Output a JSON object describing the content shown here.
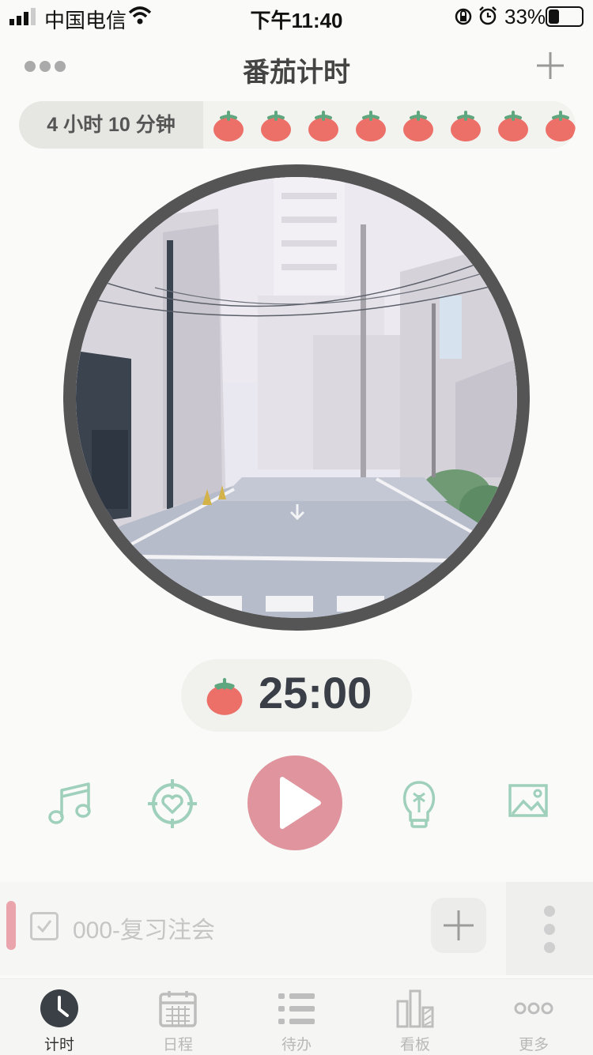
{
  "status_bar": {
    "carrier": "中国电信",
    "time": "下午11:40",
    "battery_percent": "33%",
    "battery_level": 0.33
  },
  "nav": {
    "title": "番茄计时"
  },
  "summary": {
    "total_time": "4 小时  10 分钟",
    "tomato_count_visible": 8
  },
  "timer": {
    "display": "25:00"
  },
  "controls": {
    "icons": [
      "music-note-icon",
      "target-heart-icon",
      "play-icon",
      "lightbulb-icon",
      "image-icon"
    ]
  },
  "task": {
    "label": "000-复习注会"
  },
  "tabs": [
    {
      "label": "计时",
      "icon": "clock-icon",
      "active": true
    },
    {
      "label": "日程",
      "icon": "calendar-icon",
      "active": false
    },
    {
      "label": "待办",
      "icon": "list-icon",
      "active": false
    },
    {
      "label": "看板",
      "icon": "bar-chart-icon",
      "active": false
    },
    {
      "label": "更多",
      "icon": "more-icon",
      "active": false
    }
  ],
  "colors": {
    "accent_pink": "#e0959e",
    "tomato_red": "#ec6f68",
    "leaf_green": "#5fa77f",
    "icon_mint": "#9fd0bb",
    "ring_gray": "#555555"
  }
}
